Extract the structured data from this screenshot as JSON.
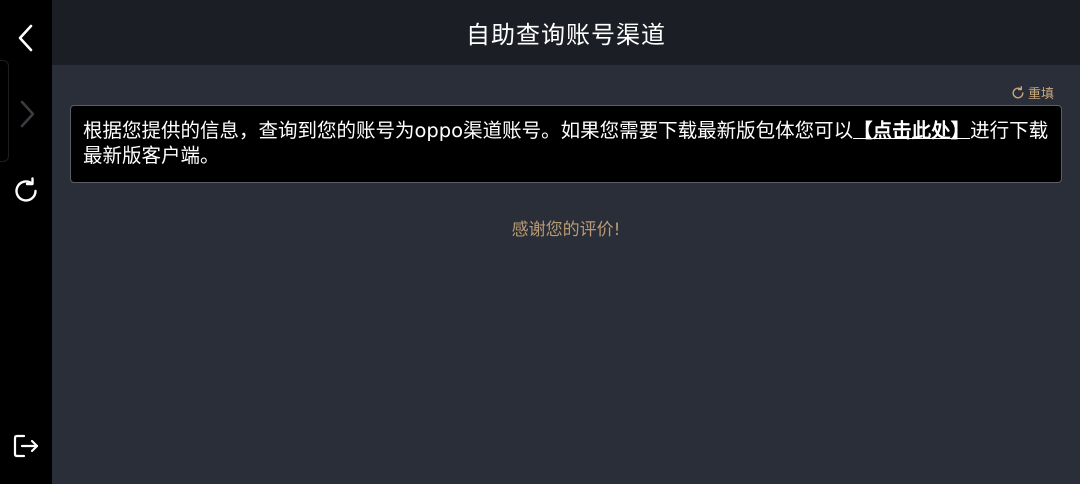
{
  "header": {
    "title": "自助查询账号渠道"
  },
  "sidebar": {
    "back_icon": "chevron-left-icon",
    "forward_icon": "chevron-right-icon",
    "refresh_icon": "refresh-icon",
    "exit_icon": "logout-icon"
  },
  "main": {
    "reset_label": "重填",
    "result_text_before": "根据您提供的信息，查询到您的账号为oppo渠道账号。如果您需要下载最新版包体您可以",
    "result_link": "【点击此处】",
    "result_text_after": "进行下载最新版客户端。",
    "thanks_text": "感谢您的评价!"
  },
  "colors": {
    "accent": "#c9a77c",
    "background": "#2a2e38",
    "topbar": "#1c1e25",
    "sidebar": "#000000"
  }
}
